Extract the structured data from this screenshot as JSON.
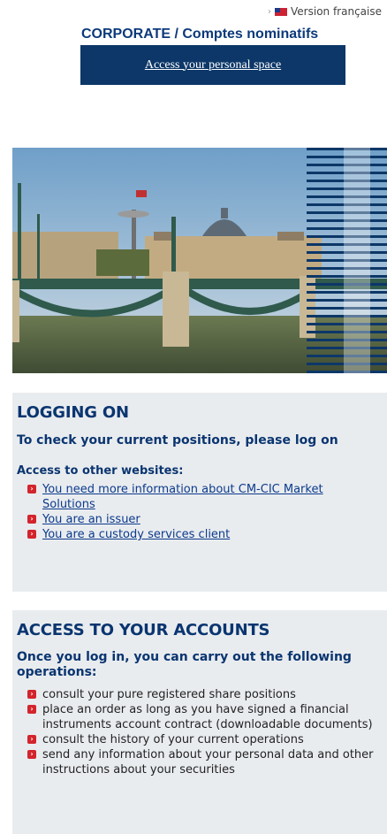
{
  "language_link": {
    "label": "Version française"
  },
  "corporate_title": "CORPORATE / Comptes nominatifs",
  "access_button": {
    "label": "Access your personal space"
  },
  "logging": {
    "title": "LOGGING ON",
    "subtitle": "To check your current positions, please log on",
    "other_sites_label": "Access to other websites:",
    "links": [
      "You need more information about CM-CIC Market Solutions",
      "You are an issuer",
      "You are a custody services client"
    ]
  },
  "accounts": {
    "title": "ACCESS TO YOUR ACCOUNTS",
    "subtitle": "Once you log in, you can carry out the following operations:",
    "operations": [
      "consult your pure registered share positions",
      "place an order as long as you have signed a financial instruments account contract (downloadable documents)",
      "consult the history of your current operations",
      "send any information about your personal data and other instructions about your securities"
    ]
  },
  "colors": {
    "navy": "#0c3768",
    "bullet_red": "#d3242c",
    "panel_grey": "#e9ecef"
  },
  "icons": [
    "chevron-right-icon",
    "uk-flag-icon",
    "red-bullet-icon"
  ]
}
